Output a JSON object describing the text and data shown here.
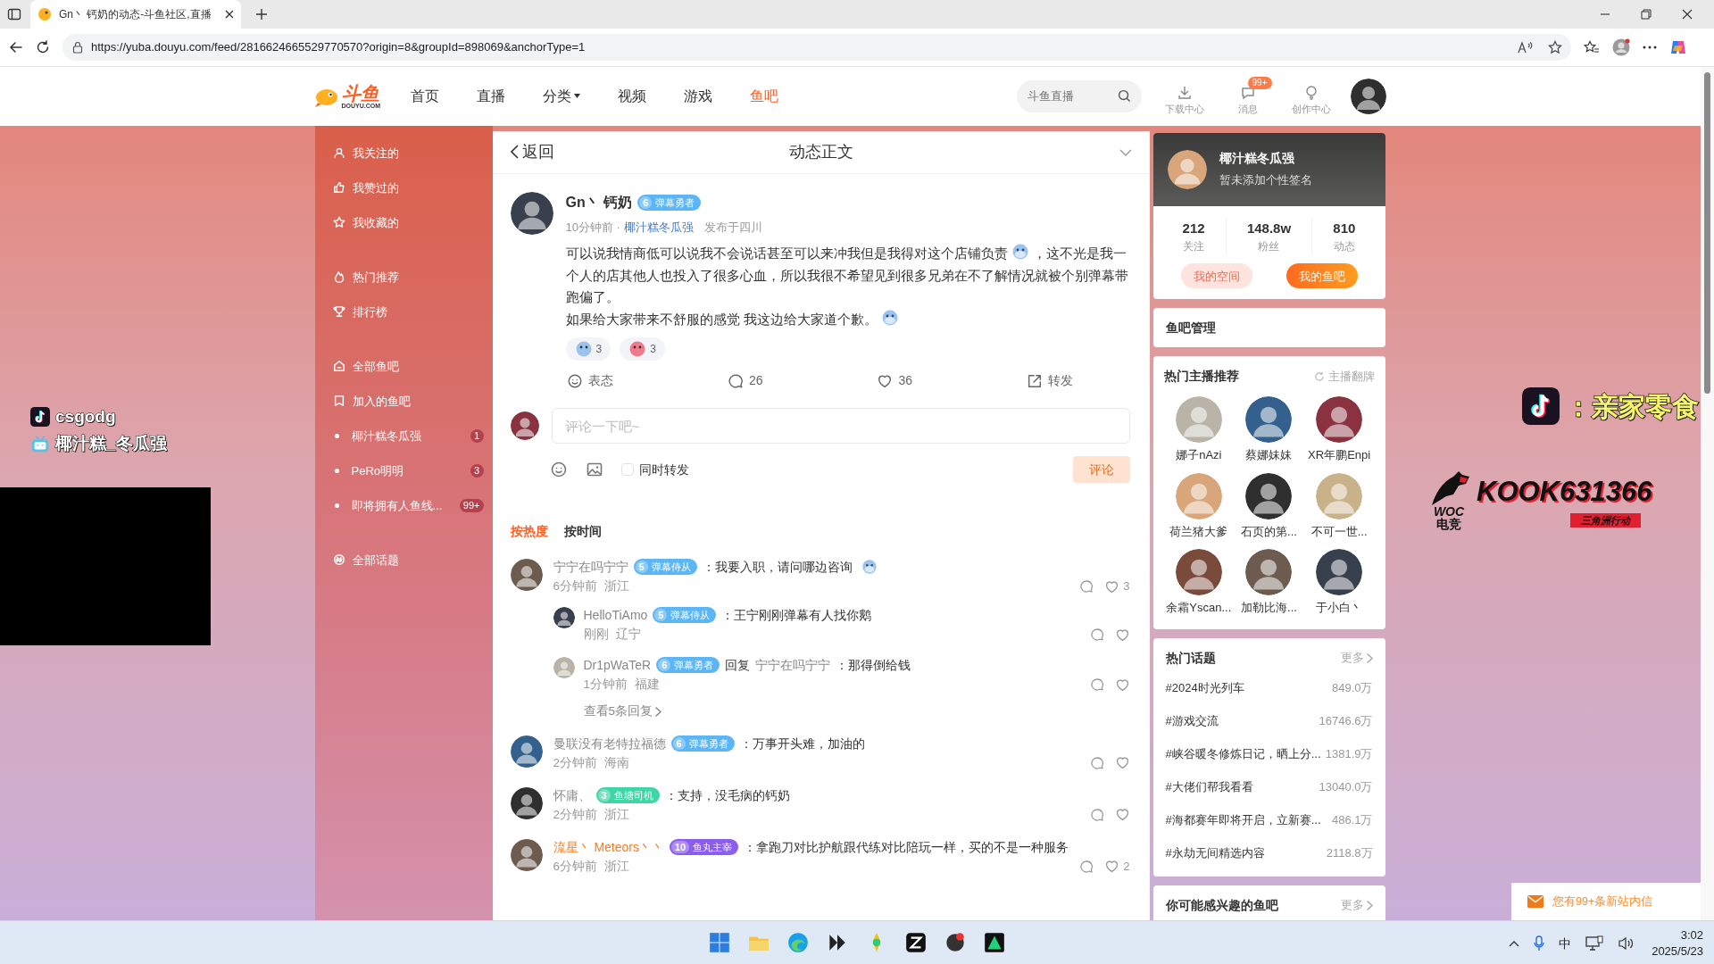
{
  "browser": {
    "tab_title": "Gn丶 钙奶的动态-斗鱼社区,直播",
    "url": "https://yuba.douyu.com/feed/2816624665529770570?origin=8&groupId=898069&anchorType=1"
  },
  "site_header": {
    "logo_text": "斗鱼",
    "logo_sub": "DOUYU.COM",
    "nav": [
      {
        "label": "首页",
        "selected": false,
        "dropdown": false
      },
      {
        "label": "直播",
        "selected": false,
        "dropdown": false
      },
      {
        "label": "分类",
        "selected": false,
        "dropdown": true
      },
      {
        "label": "视频",
        "selected": false,
        "dropdown": false
      },
      {
        "label": "游戏",
        "selected": false,
        "dropdown": false
      },
      {
        "label": "鱼吧",
        "selected": true,
        "dropdown": false
      }
    ],
    "search_placeholder": "斗鱼直播",
    "tools": [
      {
        "kind": "download",
        "label": "下载中心"
      },
      {
        "kind": "message",
        "label": "消息",
        "badge": "99+"
      },
      {
        "kind": "create",
        "label": "创作中心"
      }
    ]
  },
  "sidebar": [
    [
      {
        "kind": "link",
        "label": "我关注的"
      },
      {
        "kind": "link",
        "label": "我赞过的"
      },
      {
        "kind": "link",
        "label": "我收藏的"
      }
    ],
    [
      {
        "kind": "link",
        "label": "热门推荐"
      },
      {
        "kind": "link",
        "label": "排行榜"
      }
    ],
    [
      {
        "kind": "link",
        "label": "全部鱼吧"
      },
      {
        "kind": "link",
        "label": "加入的鱼吧"
      },
      {
        "kind": "sub",
        "label": "椰汁糕冬瓜强",
        "count": "1"
      },
      {
        "kind": "sub",
        "label": "PeRo明明",
        "count": "3"
      },
      {
        "kind": "sub",
        "label": "即将拥有人鱼线...",
        "count": "99+"
      }
    ],
    [
      {
        "kind": "link",
        "label": "全部话题"
      }
    ]
  ],
  "feed": {
    "back": "返回",
    "title": "动态正文",
    "post": {
      "author": "Gn丶 钙奶",
      "badge": {
        "level": "6",
        "label": "弹幕勇者",
        "color": "#5cb6f5"
      },
      "time": "10分钟前 ·",
      "group": "椰汁糕冬瓜强",
      "location": "发布于四川",
      "paragraphs": [
        [
          {
            "kind": "text",
            "text": "可以说我情商低可以说我不会说话甚至可以来冲我但是我得对这个店铺负责"
          },
          {
            "kind": "emoji"
          },
          {
            "kind": "text",
            "text": "，这不光是我一个人的店其他人也投入了很多心血，所以我很不希望见到很多兄弟在不了解情况就被个别弹幕带跑偏了。"
          }
        ],
        [
          {
            "kind": "text",
            "text": "如果给大家带来不舒服的感觉 我这边给大家道个歉。"
          },
          {
            "kind": "emoji"
          }
        ]
      ],
      "reactions": [
        {
          "count": "3"
        },
        {
          "count": "3"
        }
      ],
      "actions": [
        {
          "kind": "react",
          "label": "表态"
        },
        {
          "kind": "comment",
          "label": "26"
        },
        {
          "kind": "like",
          "label": "36"
        },
        {
          "kind": "share",
          "label": "转发"
        }
      ]
    },
    "composer": {
      "placeholder": "评论一下吧~",
      "repost_label": "同时转发",
      "repost_checked": false,
      "submit": "评论",
      "submit_disabled": true
    },
    "sort_tabs": [
      {
        "label": "按热度",
        "selected": true
      },
      {
        "label": "按时间",
        "selected": false
      }
    ],
    "comments": [
      {
        "name": "宁宁在吗宁宁",
        "vip": false,
        "badge": {
          "level": "5",
          "label": "弹幕侍从",
          "color": "#5cb6f5"
        },
        "text": "：我要入职，请问哪边咨询",
        "emoji": true,
        "time": "6分钟前",
        "region": "浙江",
        "likes": "3",
        "children": [
          {
            "name": "HelloTiAmo",
            "vip": false,
            "badge": {
              "level": "5",
              "label": "弹幕侍从",
              "color": "#5cb6f5"
            },
            "text": "：王宁刚刚弹幕有人找你鹅",
            "time": "刚刚",
            "region": "辽宁"
          },
          {
            "name": "Dr1pWaTeR",
            "vip": false,
            "badge": {
              "level": "6",
              "label": "弹幕勇者",
              "color": "#5cb6f5"
            },
            "reply_label": "回复",
            "reply_to": "宁宁在吗宁宁",
            "text": "：那得倒给钱",
            "time": "1分钟前",
            "region": "福建"
          }
        ],
        "more_replies": "查看5条回复"
      },
      {
        "name": "曼联没有老特拉福德",
        "vip": false,
        "badge": {
          "level": "6",
          "label": "弹幕勇者",
          "color": "#5cb6f5"
        },
        "text": "：万事开头难，加油的",
        "time": "2分钟前",
        "region": "海南"
      },
      {
        "name": "怀庸、",
        "vip": false,
        "badge": {
          "level": "3",
          "label": "鱼塘司机",
          "color": "#3fd6a6"
        },
        "text": "：支持，没毛病的钙奶",
        "time": "2分钟前",
        "region": "浙江"
      },
      {
        "name": "流星丶 Meteors丶丶",
        "vip": true,
        "badge": {
          "level": "10",
          "label": "鱼丸主宰",
          "color": "#8a5cf0"
        },
        "text": "：拿跑刀对比护航跟代练对比陪玩一样，买的不是一种服务",
        "time": "6分钟前",
        "region": "浙江",
        "likes": "2"
      }
    ]
  },
  "profile": {
    "name": "椰汁糕冬瓜强",
    "signature": "暂未添加个性签名",
    "stats": [
      {
        "value": "212",
        "label": "关注"
      },
      {
        "value": "148.8w",
        "label": "粉丝"
      },
      {
        "value": "810",
        "label": "动态"
      }
    ],
    "buttons": [
      {
        "kind": "soft",
        "label": "我的空间"
      },
      {
        "kind": "primary",
        "label": "我的鱼吧"
      }
    ]
  },
  "manage": {
    "title": "鱼吧管理"
  },
  "streamers": {
    "title": "热门主播推荐",
    "refresh": "主播翻牌",
    "items": [
      {
        "name": "娜子nAzi"
      },
      {
        "name": "蔡娜妹妹"
      },
      {
        "name": "XR年鹏Enpi"
      },
      {
        "name": "荷兰猪大爹"
      },
      {
        "name": "石页的第..."
      },
      {
        "name": "不可一世..."
      },
      {
        "name": "余霜Yscan..."
      },
      {
        "name": "加勒比海..."
      },
      {
        "name": "于小白丶"
      }
    ]
  },
  "topics": {
    "title": "热门话题",
    "more": "更多",
    "items": [
      {
        "name": "#2024时光列车",
        "count": "849.0万"
      },
      {
        "name": "#游戏交流",
        "count": "16746.6万"
      },
      {
        "name": "#峡谷暖冬修炼日记，晒上分...",
        "count": "1381.9万"
      },
      {
        "name": "#大佬们帮我看看",
        "count": "13040.0万"
      },
      {
        "name": "#海都赛年即将开启，立新赛...",
        "count": "486.1万"
      },
      {
        "name": "#永劫无间精选内容",
        "count": "2118.8万"
      }
    ]
  },
  "interested": {
    "title": "你可能感兴趣的鱼吧",
    "more": "更多"
  },
  "notification": "您有99+条新站内信",
  "overlays": {
    "left": [
      {
        "kind": "tiktok",
        "text": "csgodg"
      },
      {
        "kind": "bilibili",
        "text": "椰汁糕_冬瓜强"
      }
    ],
    "right_handle": "：亲家零食",
    "logo_top": "WOC",
    "logo_bottom": "电竞",
    "code": "KOOK631366",
    "code_sub": "三角洲行动"
  },
  "taskbar": {
    "ime": "中",
    "time": "3:02",
    "date": "2025/5/23"
  }
}
